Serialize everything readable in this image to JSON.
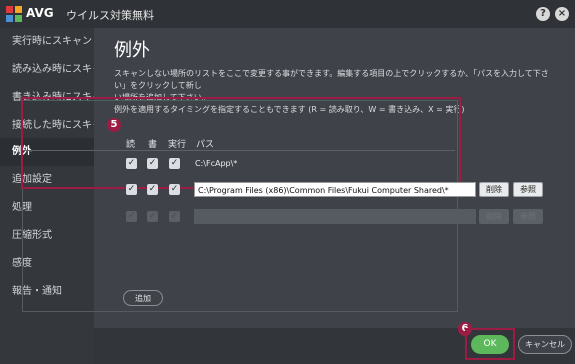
{
  "titlebar": {
    "brand": "AVG",
    "title": "ウイルス対策無料",
    "help_glyph": "?",
    "close_glyph": "×"
  },
  "sidebar": {
    "items": [
      {
        "label": "実行時にスキャン"
      },
      {
        "label": "読み込み時にスキャン"
      },
      {
        "label": "書き込み時にスキャン"
      },
      {
        "label": "接続した時にスキャン"
      },
      {
        "label": "例外",
        "active": true
      },
      {
        "label": "追加設定"
      },
      {
        "label": "処理"
      },
      {
        "label": "圧縮形式"
      },
      {
        "label": "感度"
      },
      {
        "label": "報告・通知"
      }
    ]
  },
  "main": {
    "title": "例外",
    "description_line1": "スキャンしない場所のリストをここで変更する事ができます。編集する項目の上でクリックするか、「パスを入力して下さい」をクリックして新し",
    "description_line2": "い場所を追加して下さい。",
    "description_line3": "例外を適用するタイミングを指定することもできます (R = 読み取り、W = 書き込み、X = 実行)"
  },
  "table": {
    "headers": {
      "read": "読",
      "write": "書",
      "exec": "実行",
      "path": "パス"
    },
    "rows": [
      {
        "read": true,
        "write": true,
        "exec": true,
        "path": "C:\\FcApp\\*"
      },
      {
        "read": true,
        "write": true,
        "exec": true,
        "path": "C:\\Program Files (x86)\\Common Files\\Fukui Computer Shared\\*",
        "editing": true
      },
      {
        "read": true,
        "write": true,
        "exec": true,
        "path": "",
        "disabled": true
      }
    ],
    "delete_label": "削除",
    "browse_label": "参照",
    "check_glyph": "✓"
  },
  "add_button": "追加",
  "footer": {
    "ok": "OK",
    "cancel": "キャンセル"
  },
  "markers": {
    "table_marker": "5",
    "ok_marker": "6"
  },
  "colors": {
    "marker": "#9b1d44",
    "ok_green": "#5db85c",
    "background": "#3f4248"
  }
}
